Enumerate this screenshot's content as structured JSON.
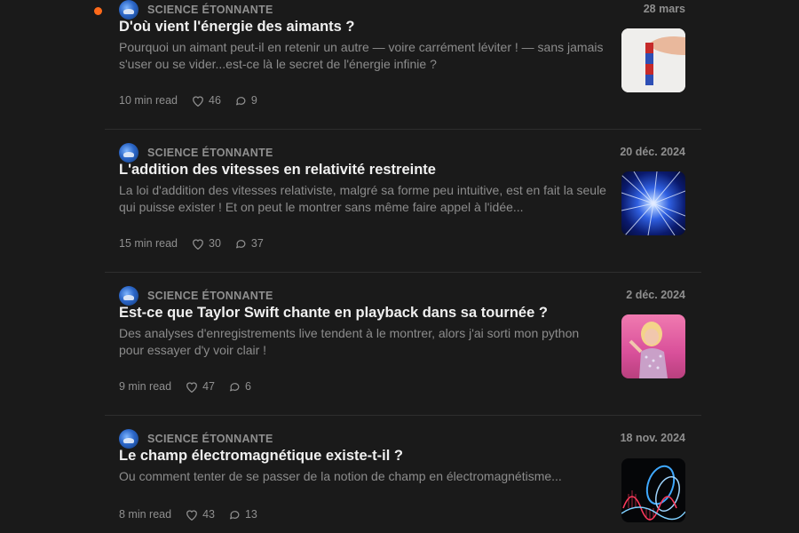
{
  "feed": {
    "posts": [
      {
        "publication": "SCIENCE ÉTONNANTE",
        "date": "28 mars",
        "unread": true,
        "title": "D'où vient l'énergie des aimants ?",
        "subtitle": "Pourquoi un aimant peut-il en retenir un autre — voire carrément léviter ! — sans jamais s'user ou se vider...est-ce là le secret de l'énergie infinie ?",
        "read_time": "10 min read",
        "likes": "46",
        "comments": "9",
        "thumbnail": "magnets-photo"
      },
      {
        "publication": "SCIENCE ÉTONNANTE",
        "date": "20 déc. 2024",
        "unread": false,
        "title": "L'addition des vitesses en relativité restreinte",
        "subtitle": "La loi d'addition des vitesses relativiste, malgré sa forme peu intuitive, est en fait la seule qui puisse exister ! Et on peut le montrer sans même faire appel à l'idée...",
        "read_time": "15 min read",
        "likes": "30",
        "comments": "37",
        "thumbnail": "hyperspace-image"
      },
      {
        "publication": "SCIENCE ÉTONNANTE",
        "date": "2 déc. 2024",
        "unread": false,
        "title": "Est-ce que Taylor Swift chante en playback dans sa tournée ?",
        "subtitle": "Des analyses d'enregistrements live tendent à le montrer, alors j'ai sorti mon python pour essayer d'y voir clair !",
        "read_time": "9 min read",
        "likes": "47",
        "comments": "6",
        "thumbnail": "singer-photo"
      },
      {
        "publication": "SCIENCE ÉTONNANTE",
        "date": "18 nov. 2024",
        "unread": false,
        "title": "Le champ électromagnétique existe-t-il ?",
        "subtitle": "Ou comment tenter de se passer de la notion de champ en électromagnétisme...",
        "read_time": "8 min read",
        "likes": "43",
        "comments": "13",
        "thumbnail": "em-wave-image"
      }
    ]
  },
  "colors": {
    "background": "#1a1a1a",
    "unread_dot": "#ff6a1a",
    "muted_text": "#8f8f8f",
    "title_text": "#f0f0f0"
  },
  "icons": {
    "like": "heart-icon",
    "comment": "comment-bubble-icon"
  }
}
